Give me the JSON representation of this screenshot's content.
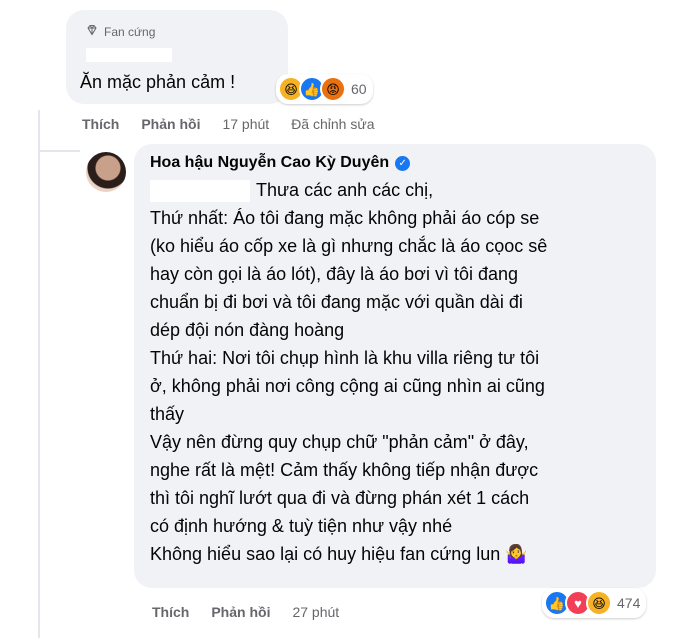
{
  "comment1": {
    "badge_label": "Fan cứng",
    "text": "Ăn mặc phản cảm !",
    "reaction_count": "60",
    "actions": {
      "like": "Thích",
      "reply": "Phản hồi",
      "time": "17 phút",
      "edited": "Đã chỉnh sửa"
    }
  },
  "reply": {
    "author": "Hoa hậu Nguyễn Cao Kỳ Duyên",
    "lines": [
      "Thưa các anh các chị,",
      "Thứ nhất: Áo tôi đang mặc không phải áo cóp se",
      "(ko hiểu áo cốp xe là gì nhưng chắc là áo cọoc sê",
      "hay còn gọi là áo lót), đây là áo bơi vì tôi đang",
      "chuẩn bị đi bơi và tôi đang mặc với quần dài đi",
      "dép đội nón đàng hoàng",
      "Thứ hai: Nơi tôi chụp hình là khu villa riêng tư tôi",
      "ở, không phải nơi công cộng ai cũng nhìn ai cũng",
      "thấy",
      "Vậy nên đừng quy chụp chữ \"phản cảm\" ở đây,",
      "nghe rất là mệt! Cảm thấy không tiếp nhận được",
      "thì tôi nghĩ lướt qua đi và đừng phán xét 1 cách",
      "có định hướng & tuỳ tiện như vậy nhé",
      "Không hiểu sao lại có huy hiệu fan cứng lun 🤷‍♀️"
    ],
    "reaction_count": "474",
    "actions": {
      "like": "Thích",
      "reply": "Phản hồi",
      "time": "27 phút"
    }
  }
}
